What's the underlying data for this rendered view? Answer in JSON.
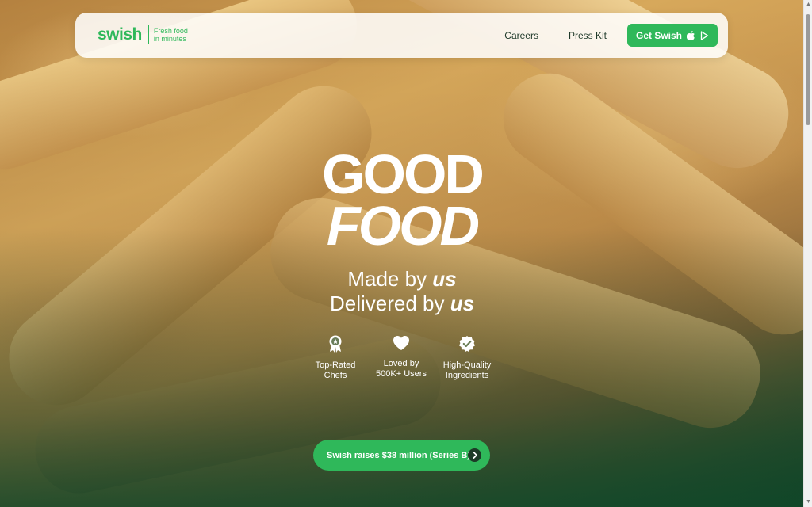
{
  "brand": {
    "logo_text": "swish",
    "tagline_line1": "Fresh food",
    "tagline_line2": "in minutes"
  },
  "nav": {
    "links": [
      {
        "label": "Careers"
      },
      {
        "label": "Press Kit"
      }
    ],
    "cta_label": "Get Swish",
    "cta_icons": [
      "apple-icon",
      "play-store-icon"
    ]
  },
  "hero": {
    "headline_line1": "GOOD",
    "headline_line2": "FOOD",
    "sub_line1_prefix": "Made by ",
    "sub_line1_emph": "us",
    "sub_line2_prefix": "Delivered by ",
    "sub_line2_emph": "us"
  },
  "features": [
    {
      "icon": "award-ribbon-icon",
      "line1": "Top-Rated",
      "line2": "Chefs"
    },
    {
      "icon": "heart-icon",
      "line1": "Loved by",
      "line2": "500K+ Users"
    },
    {
      "icon": "verified-badge-icon",
      "line1": "High-Quality",
      "line2": "Ingredients"
    }
  ],
  "announcement": {
    "label": "Swish raises $38 million (Series B)",
    "icon": "chevron-right-icon"
  },
  "colors": {
    "accent": "#2fb85a",
    "dark_green": "#1d3b27",
    "text_light": "#ffffff"
  }
}
